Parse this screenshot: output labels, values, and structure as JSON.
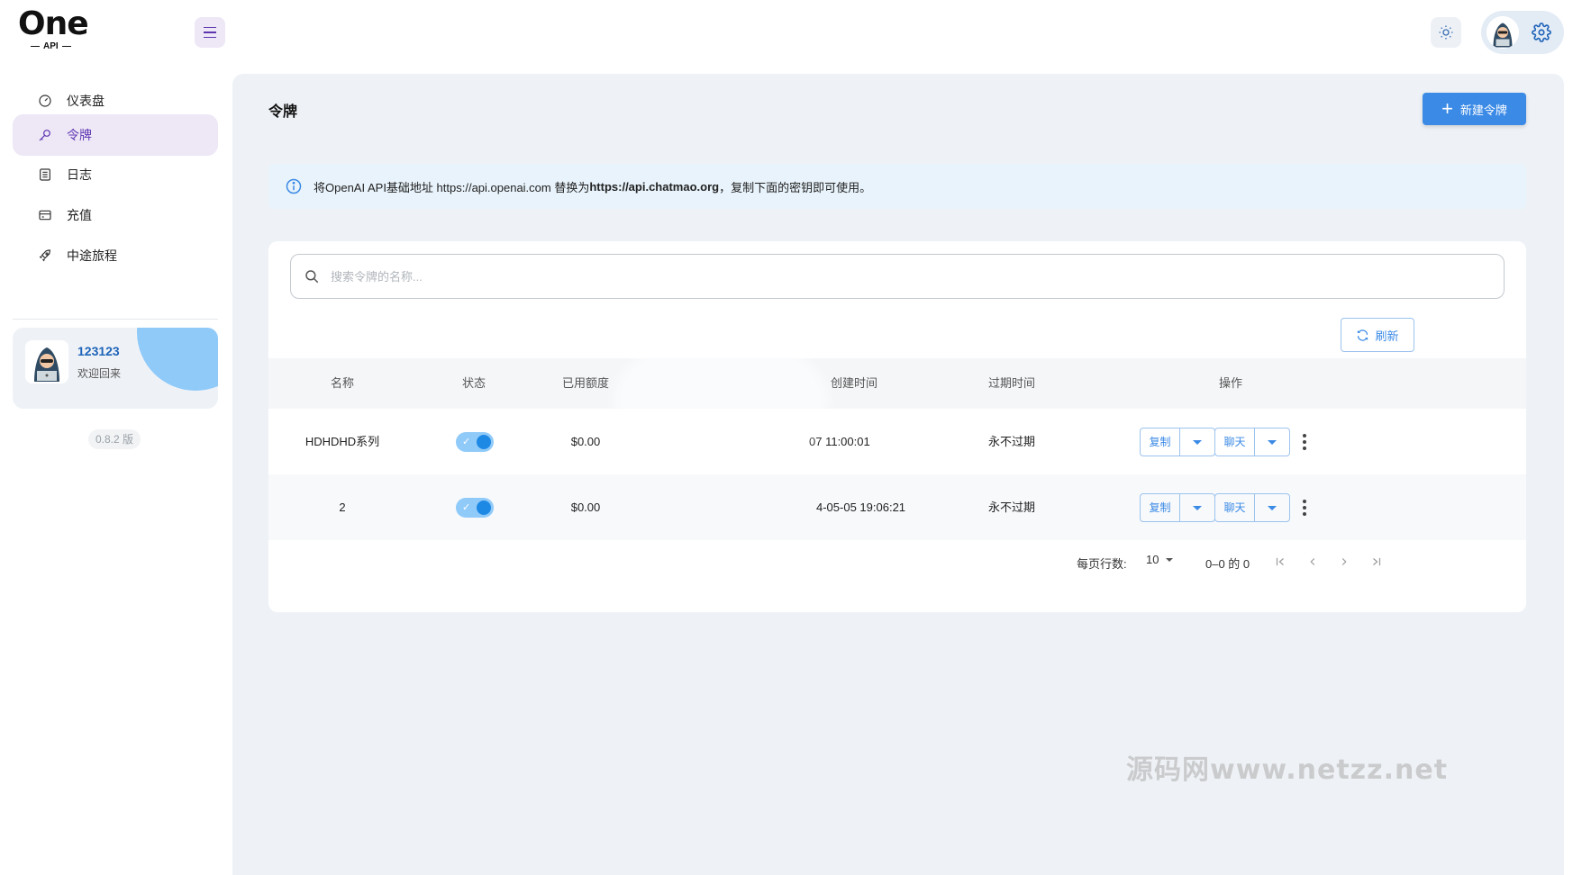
{
  "header": {
    "logo_main": "One",
    "logo_sub": "API"
  },
  "sidebar": {
    "items": [
      {
        "label": "仪表盘",
        "icon": "dashboard-icon"
      },
      {
        "label": "令牌",
        "icon": "key-icon",
        "active": true
      },
      {
        "label": "日志",
        "icon": "log-icon"
      },
      {
        "label": "充值",
        "icon": "wallet-icon"
      },
      {
        "label": "中途旅程",
        "icon": "rocket-icon"
      }
    ],
    "user": {
      "name": "123123",
      "welcome": "欢迎回来"
    },
    "version": "0.8.2 版"
  },
  "page": {
    "title": "令牌",
    "new_button": "新建令牌",
    "alert": {
      "prefix": "将OpenAI API基础地址 https://api.openai.com 替换为 ",
      "url": "https://api.chatmao.org",
      "suffix": "，复制下面的密钥即可使用。"
    },
    "search_placeholder": "搜索令牌的名称...",
    "refresh_label": "刷新"
  },
  "table": {
    "columns": [
      "名称",
      "状态",
      "已用额度",
      "创建时间",
      "过期时间",
      "操作"
    ],
    "rows": [
      {
        "name": "HDHDHD系列",
        "enabled": true,
        "used": "$0.00",
        "created": "07 11:00:01",
        "expires": "永不过期"
      },
      {
        "name": "2",
        "enabled": true,
        "used": "$0.00",
        "created": "4-05-05 19:06:21",
        "expires": "永不过期"
      }
    ],
    "actions": {
      "copy": "复制",
      "chat": "聊天"
    }
  },
  "pagination": {
    "rows_per_page_label": "每页行数:",
    "rows_per_page": "10",
    "range": "0–0 的 0"
  },
  "watermark": "源码网www.netzz.net",
  "colors": {
    "accent": "#3b8ae6",
    "purple": "#5e35b1",
    "toggle_on": "#1e88e5"
  }
}
